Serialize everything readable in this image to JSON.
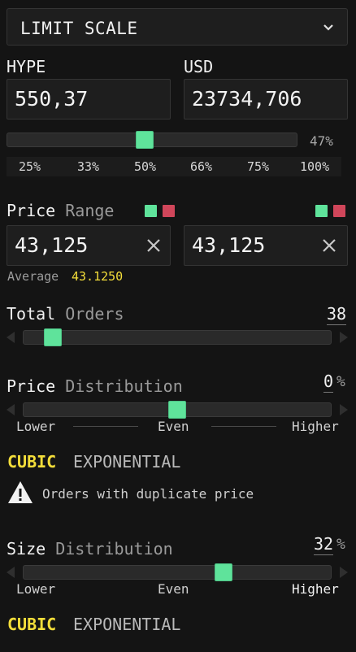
{
  "header": {
    "dropdown_label": "LIMIT SCALE"
  },
  "amounts": {
    "base": {
      "label": "HYPE",
      "value": "550,37"
    },
    "quote": {
      "label": "USD",
      "value": "23734,706"
    }
  },
  "size_slider": {
    "value_label": "47%",
    "value": 47,
    "presets": [
      "25%",
      "33%",
      "50%",
      "66%",
      "75%",
      "100%"
    ]
  },
  "price_range": {
    "label_main": "Price",
    "label_sub": "Range",
    "low": "43,125",
    "high": "43,125",
    "average_label": "Average",
    "average_value": "43.1250"
  },
  "total_orders": {
    "label_main": "Total",
    "label_sub": "Orders",
    "value": "38",
    "slider_fraction": 0.1
  },
  "price_distribution": {
    "label_main": "Price",
    "label_sub": "Distribution",
    "value": "0",
    "unit": "%",
    "slider_fraction": 0.5,
    "scale": [
      "Lower",
      "Even",
      "Higher"
    ],
    "modes": {
      "cubic": "CUBIC",
      "exponential": "EXPONENTIAL"
    },
    "warning": "Orders with duplicate price"
  },
  "size_distribution": {
    "label_main": "Size",
    "label_sub": "Distribution",
    "value": "32",
    "unit": "%",
    "slider_fraction": 0.66,
    "scale": [
      "Lower",
      "Even",
      "Higher"
    ],
    "modes": {
      "cubic": "CUBIC",
      "exponential": "EXPONENTIAL"
    }
  },
  "colors": {
    "accent_green": "#5fe39b",
    "accent_red": "#d0465a",
    "highlight_yellow": "#f4de3a"
  }
}
